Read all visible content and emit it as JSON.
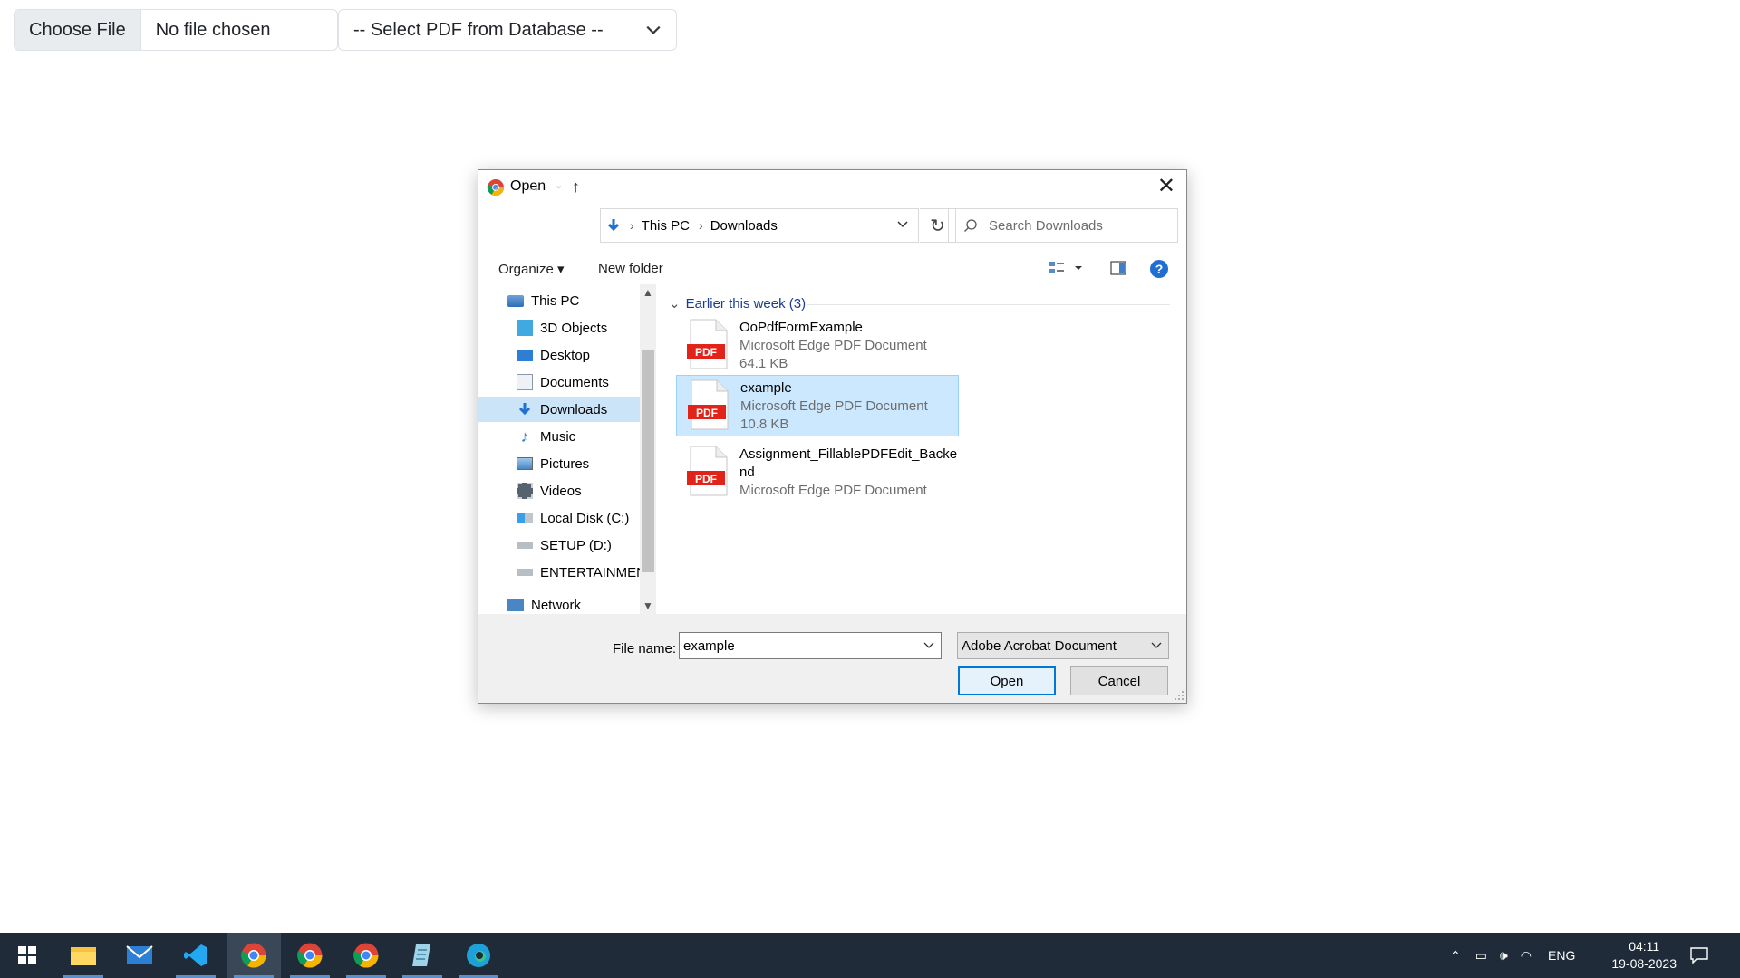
{
  "page": {
    "file_button": "Choose File",
    "file_status": "No file chosen",
    "select_value": "-- Select PDF from Database --"
  },
  "dialog": {
    "title": "Open",
    "address": {
      "root": "This PC",
      "current": "Downloads"
    },
    "search_placeholder": "Search Downloads",
    "toolbar": {
      "organize": "Organize",
      "new_folder": "New folder"
    },
    "nav_items": [
      {
        "label": "This PC",
        "icon": "pc-icon"
      },
      {
        "label": "3D Objects",
        "icon": "cube-icon"
      },
      {
        "label": "Desktop",
        "icon": "desktop-icon"
      },
      {
        "label": "Documents",
        "icon": "documents-icon"
      },
      {
        "label": "Downloads",
        "icon": "download-icon",
        "selected": true
      },
      {
        "label": "Music",
        "icon": "music-icon"
      },
      {
        "label": "Pictures",
        "icon": "pictures-icon"
      },
      {
        "label": "Videos",
        "icon": "videos-icon"
      },
      {
        "label": "Local Disk (C:)",
        "icon": "disk-icon"
      },
      {
        "label": "SETUP (D:)",
        "icon": "drive-icon"
      },
      {
        "label": "ENTERTAINMEN",
        "icon": "drive-icon"
      },
      {
        "label": "Network",
        "icon": "network-icon"
      }
    ],
    "group_header": "Earlier this week (3)",
    "files": [
      {
        "name": "OoPdfFormExample",
        "type": "Microsoft Edge PDF Document",
        "size": "64.1 KB"
      },
      {
        "name": "example",
        "type": "Microsoft Edge PDF Document",
        "size": "10.8 KB",
        "selected": true
      },
      {
        "name_line1": "Assignment_FillablePDFEdit_Backe",
        "name_line2": "nd",
        "type": "Microsoft Edge PDF Document"
      }
    ],
    "pdf_badge": "PDF",
    "file_name_label": "File name:",
    "file_name_value": "example",
    "file_type_value": "Adobe Acrobat Document",
    "open_button": "Open",
    "cancel_button": "Cancel"
  },
  "taskbar": {
    "language": "ENG",
    "time": "04:11",
    "date": "19-08-2023"
  },
  "colors": {
    "selection": "#cce8ff",
    "accent": "#0078d7",
    "pdf_red": "#e2231a",
    "taskbar": "#1f2b38"
  }
}
